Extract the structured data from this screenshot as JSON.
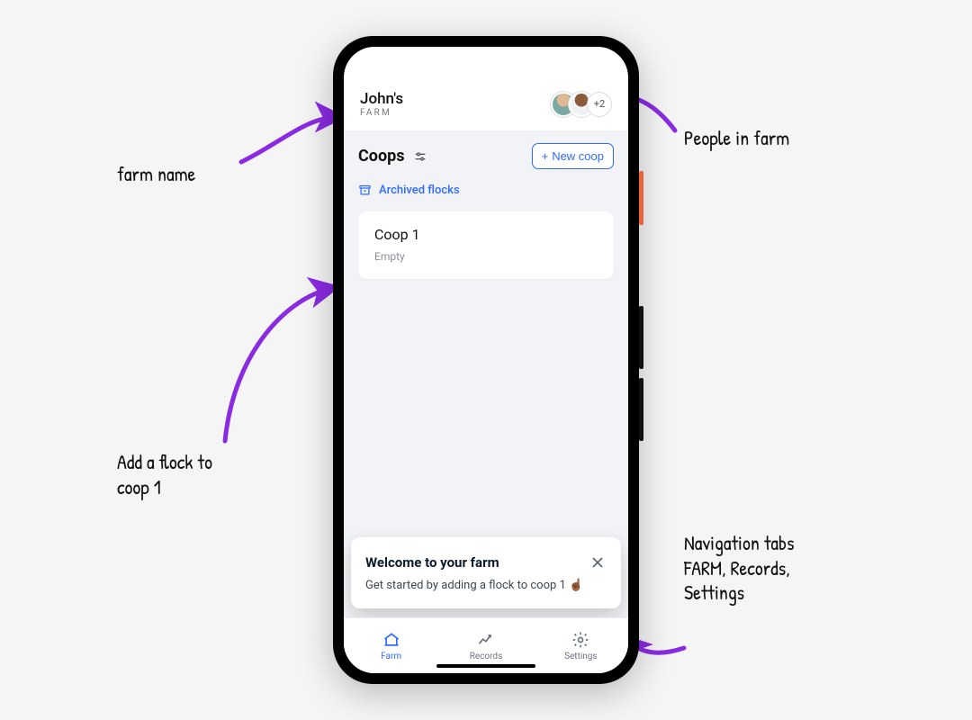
{
  "header": {
    "farm_name": "John's",
    "farm_label": "FARM",
    "people_more": "+2"
  },
  "coops": {
    "title": "Coops",
    "new_button": "New coop",
    "archived_label": "Archived flocks",
    "cards": [
      {
        "name": "Coop 1",
        "status": "Empty"
      }
    ]
  },
  "toast": {
    "title": "Welcome to your farm",
    "body": "Get started by adding a flock to coop 1 ☝🏾"
  },
  "nav": {
    "farm": "Farm",
    "records": "Records",
    "settings": "Settings"
  },
  "annotations": {
    "farm_name": "farm name",
    "people": "People in farm",
    "add_flock": "Add a flock to\ncoop 1",
    "tabs": "Navigation tabs\nFARM, Records,\nSettings"
  },
  "colors": {
    "accent": "#2f6bff",
    "arrow": "#8a2be2"
  }
}
